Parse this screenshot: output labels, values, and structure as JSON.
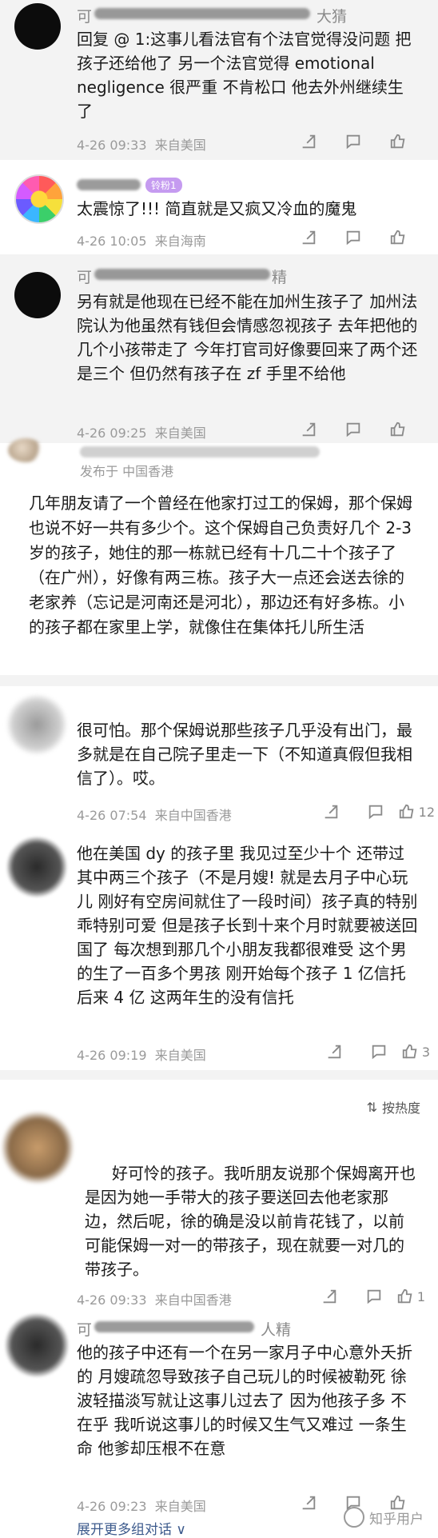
{
  "comments": [
    {
      "name": "可",
      "name_tail": "大猜",
      "text": "回复 @                1:这事儿看法官有个法官觉得没问题 把孩子还给他了 另一个法官觉得 emotional negligence 很严重 不肯松口 他去外州继续生了",
      "time": "4-26 09:33",
      "location": "来自美国"
    },
    {
      "badge": "铃粉1",
      "text": "太震惊了!!!  简直就是又疯又冷血的魔鬼",
      "time": "4-26 10:05",
      "location": "来自海南"
    },
    {
      "name": "可",
      "name_tail": "精",
      "text": "另有就是他现在已经不能在加州生孩子了 加州法院认为他虽然有钱但会情感忽视孩子 去年把他的几个小孩带走了 今年打官司好像要回来了两个还是三个 但仍然有孩子在 zf 手里不给他",
      "time": "4-26 09:25",
      "location": "来自美国"
    },
    {
      "sub_meta": "发布于 中国香港",
      "text": "几年朋友请了一个曾经在他家打过工的保姆，那个保姆也说不好一共有多少个。这个保姆自己负责好几个 2-3 岁的孩子，她住的那一栋就已经有十几二十个孩子了（在广州），好像有两三栋。孩子大一点还会送去徐的老家养（忘记是河南还是河北），那边还有好多栋。小的孩子都在家里上学，就像住在集体托儿所生活"
    },
    {
      "text": "很可怕。那个保姆说那些孩子几乎没有出门，最多就是在自己院子里走一下（不知道真假但我相信了）。哎。",
      "time": "4-26 07:54",
      "location": "来自中国香港",
      "likes": "12"
    },
    {
      "text": "他在美国 dy 的孩子里 我见过至少十个 还带过其中两三个孩子（不是月嫂! 就是去月子中心玩儿 刚好有空房间就住了一段时间）孩子真的特别乖特别可爱 但是孩子长到十来个月时就要被送回国了 每次想到那几个小朋友我都很难受 这个男的生了一百多个男孩 刚开始每个孩子 1 亿信托 后来 4 亿 这两年生的没有信托",
      "time": "4-26 09:19",
      "location": "来自美国",
      "likes": "3"
    },
    {
      "text": "好可怜的孩子。我听朋友说那个保姆离开也是因为她一手带大的孩子要送回去他老家那边，然后呢，徐的确是没以前肯花钱了，以前可能保姆一对一的带孩子，现在就要一对几的带孩子。",
      "time": "4-26 09:33",
      "location": "来自中国香港",
      "likes": "1"
    },
    {
      "name": "可",
      "name_tail": "人精",
      "text": "他的孩子中还有一个在另一家月子中心意外夭折的 月嫂疏忽导致孩子自己玩儿的时候被勒死 徐波轻描淡写就让这事儿过去了 因为他孩子多 不在乎 我听说这事儿的时候又生气又难过 一条生命 他爹却压根不在意",
      "time": "4-26 09:23",
      "location": "来自美国"
    }
  ],
  "sort_label": "按热度",
  "expand_label": "展开更多组对话 ∨",
  "watermark": "知乎用户",
  "colors": {
    "meta": "#9a9a9a",
    "link": "#3c5a8c",
    "badge": "#c59bf0"
  }
}
